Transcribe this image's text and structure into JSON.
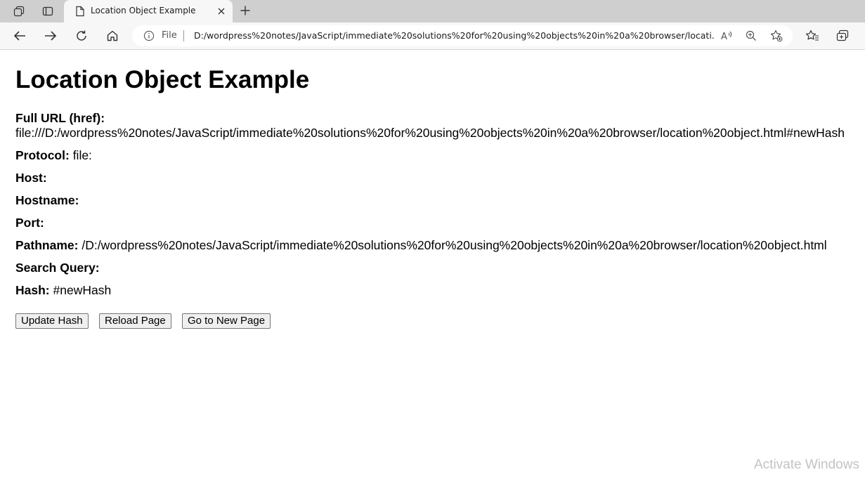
{
  "browser": {
    "tab": {
      "title": "Location Object Example"
    },
    "address_bar": {
      "scheme_label": "File",
      "url": "D:/wordpress%20notes/JavaScript/immediate%20solutions%20for%20using%20objects%20in%20a%20browser/locati..."
    },
    "icons": {
      "workspaces": "workspaces-icon",
      "tab_actions": "tab-actions-icon",
      "tab_page": "page-icon",
      "tab_close": "close-icon",
      "new_tab": "plus-icon",
      "back": "back-arrow-icon",
      "forward": "forward-arrow-icon",
      "refresh": "refresh-icon",
      "home": "home-icon",
      "site_info": "info-icon",
      "read_aloud": "read-aloud-icon",
      "zoom": "zoom-icon",
      "add_favorite": "add-favorite-icon",
      "favorites": "favorites-icon",
      "collections": "collections-icon"
    }
  },
  "page": {
    "heading": "Location Object Example",
    "fields": [
      {
        "label": "Full URL (href):",
        "value": "file:///D:/wordpress%20notes/JavaScript/immediate%20solutions%20for%20using%20objects%20in%20a%20browser/location%20object.html#newHash"
      },
      {
        "label": "Protocol:",
        "value": "file:"
      },
      {
        "label": "Host:",
        "value": ""
      },
      {
        "label": "Hostname:",
        "value": ""
      },
      {
        "label": "Port:",
        "value": ""
      },
      {
        "label": "Pathname:",
        "value": "/D:/wordpress%20notes/JavaScript/immediate%20solutions%20for%20using%20objects%20in%20a%20browser/location%20object.html"
      },
      {
        "label": "Search Query:",
        "value": ""
      },
      {
        "label": "Hash:",
        "value": "#newHash"
      }
    ],
    "buttons": {
      "update_hash": "Update Hash",
      "reload_page": "Reload Page",
      "go_new_page": "Go to New Page"
    }
  },
  "os": {
    "watermark": "Activate Windows"
  }
}
